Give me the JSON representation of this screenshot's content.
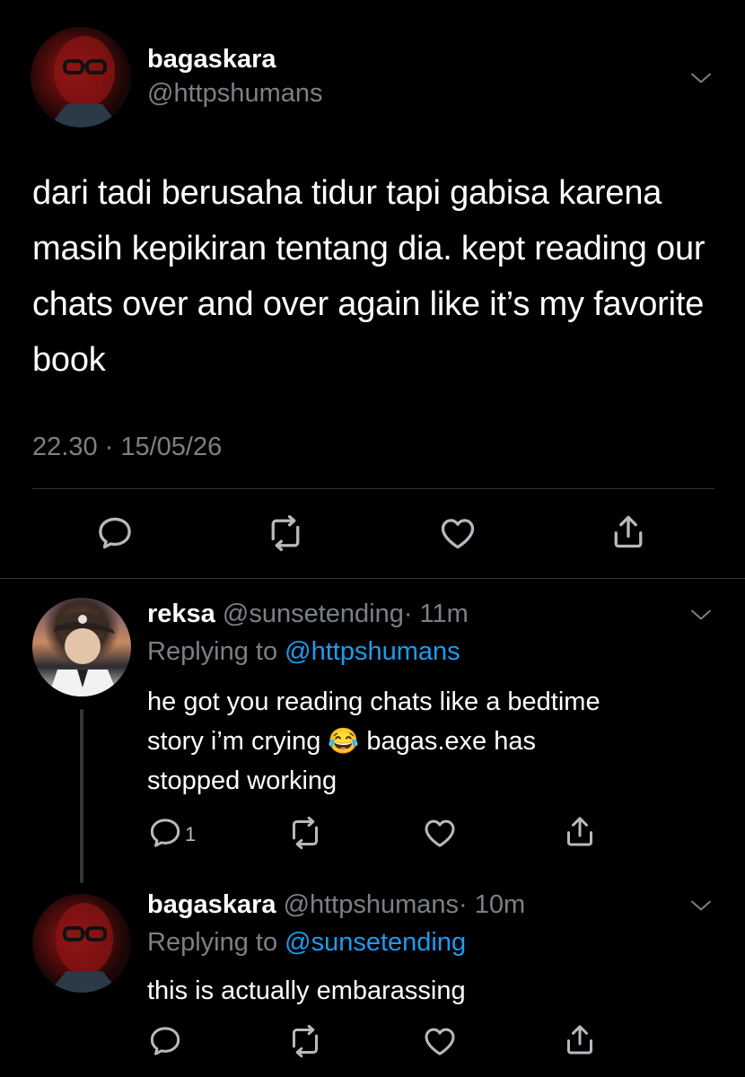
{
  "main_tweet": {
    "display_name": "bagaskara",
    "handle": "@httpshumans",
    "text": "dari tadi berusaha tidur tapi gabisa karena masih kepikiran tentang dia. kept reading our chats over and over again like it’s my favorite book",
    "timestamp": "22.30 · 15/05/26"
  },
  "replies": [
    {
      "display_name": "reksa",
      "handle": "@sunsetending",
      "time": "· 11m",
      "replying_label": "Replying to",
      "replying_to": "@httpshumans",
      "text_a": "he got you reading chats like a bedtime",
      "text_b": "story i’m crying",
      "emoji": "😂",
      "text_c": "bagas.exe has",
      "text_d": "stopped working",
      "reply_count": "1"
    },
    {
      "display_name": "bagaskara",
      "handle": "@httpshumans",
      "time": "· 10m",
      "replying_label": "Replying to",
      "replying_to": "@sunsetending",
      "text": "this is actually embarassing"
    }
  ],
  "icons": [
    "chevron-down-icon",
    "reply-icon",
    "retweet-icon",
    "like-icon",
    "share-icon"
  ],
  "colors": {
    "background": "#000000",
    "text": "#ffffff",
    "secondary": "#7b8086",
    "link": "#1d9bf0",
    "divider": "#2f3336"
  }
}
